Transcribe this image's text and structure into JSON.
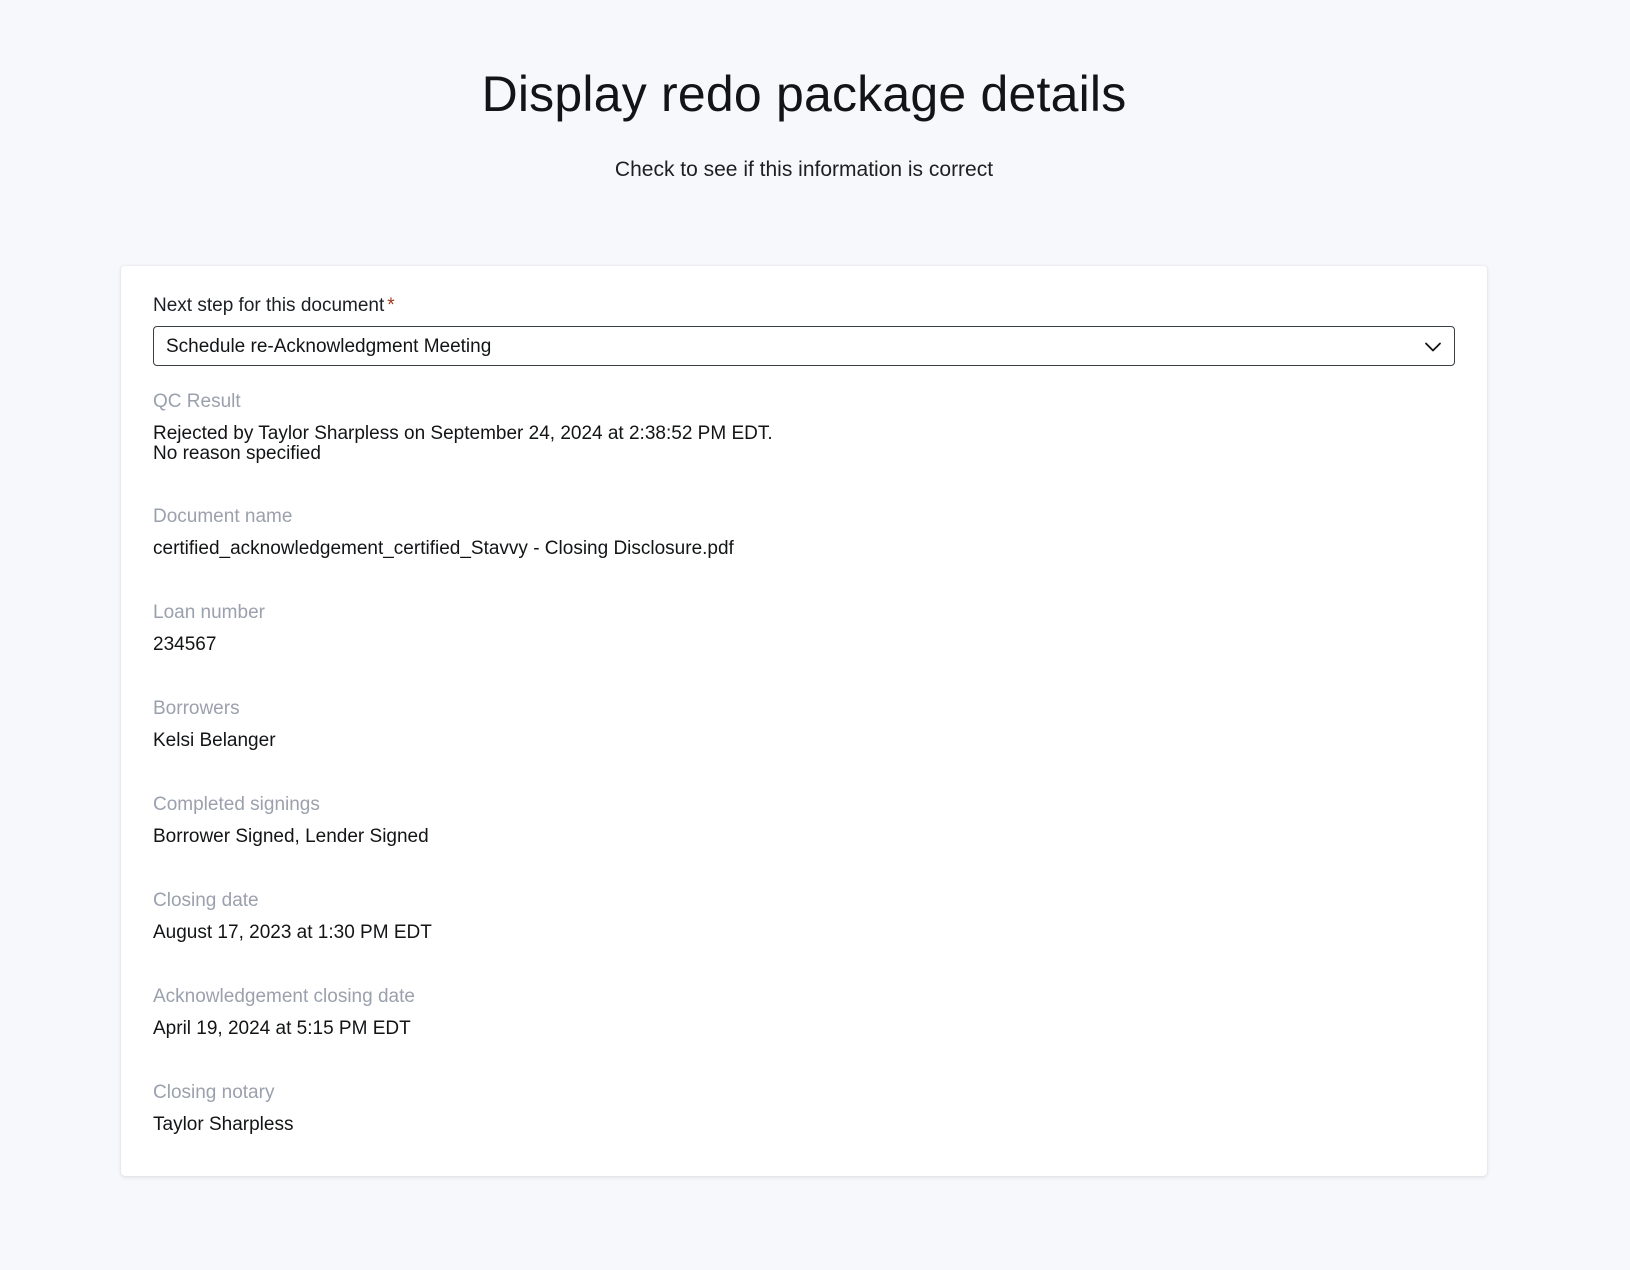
{
  "page": {
    "title": "Display redo package details",
    "subtitle": "Check to see if this information is correct"
  },
  "form": {
    "next_step_label": "Next step for this document",
    "required_marker": "*",
    "next_step_value": "Schedule re-Acknowledgment Meeting",
    "next_step_icon": "chevron-down-icon"
  },
  "details": {
    "qc_result": {
      "label": "QC Result",
      "line1": "Rejected by Taylor Sharpless on September 24, 2024 at 2:38:52 PM EDT.",
      "line2": "No reason specified"
    },
    "document_name": {
      "label": "Document name",
      "value": "certified_acknowledgement_certified_Stavvy - Closing Disclosure.pdf"
    },
    "loan_number": {
      "label": "Loan number",
      "value": "234567"
    },
    "borrowers": {
      "label": "Borrowers",
      "value": "Kelsi Belanger"
    },
    "completed_signings": {
      "label": "Completed signings",
      "value": "Borrower Signed, Lender Signed"
    },
    "closing_date": {
      "label": "Closing date",
      "value": "August 17, 2023 at 1:30 PM EDT"
    },
    "acknowledgement_closing_date": {
      "label": "Acknowledgement closing date",
      "value": "April 19, 2024 at 5:15 PM EDT"
    },
    "closing_notary": {
      "label": "Closing notary",
      "value": "Taylor Sharpless"
    }
  },
  "colors": {
    "background": "#f7f8fc",
    "card": "#ffffff",
    "label_muted": "#9aa1ad",
    "required": "#a2351c",
    "text": "#121416"
  }
}
